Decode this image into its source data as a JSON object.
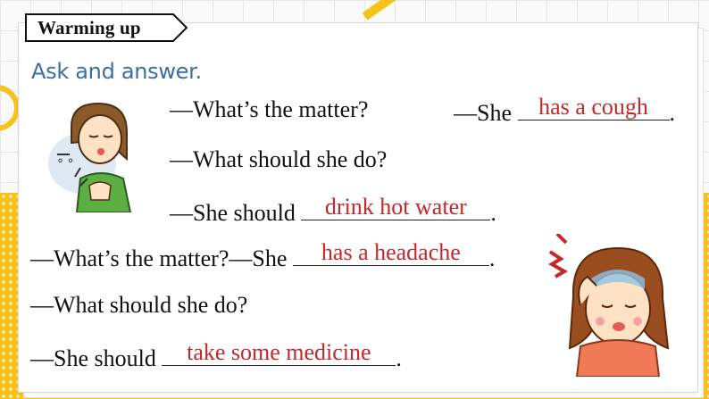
{
  "title_tab": "Warming up",
  "subtitle": "Ask and answer.",
  "dialogue": [
    {
      "lead": "—What’s the matter?",
      "pre": "—She",
      "answer": "has a cough",
      "post": "."
    },
    {
      "lead": "—What should she do?"
    },
    {
      "pre": "—She should",
      "answer": "drink hot water",
      "post": "."
    },
    {
      "pre": "—What’s the matter?—She",
      "answer": "has a headache",
      "post": "."
    },
    {
      "lead": "—What should she do?"
    },
    {
      "pre": "—She should",
      "answer": "take some medicine",
      "post": "."
    }
  ],
  "colors": {
    "accent_yellow": "#f7c21a",
    "subtitle_blue": "#3a6ea5",
    "answer_red": "#c4282b"
  },
  "illustrations": [
    "coughing-woman",
    "headache-girl"
  ]
}
